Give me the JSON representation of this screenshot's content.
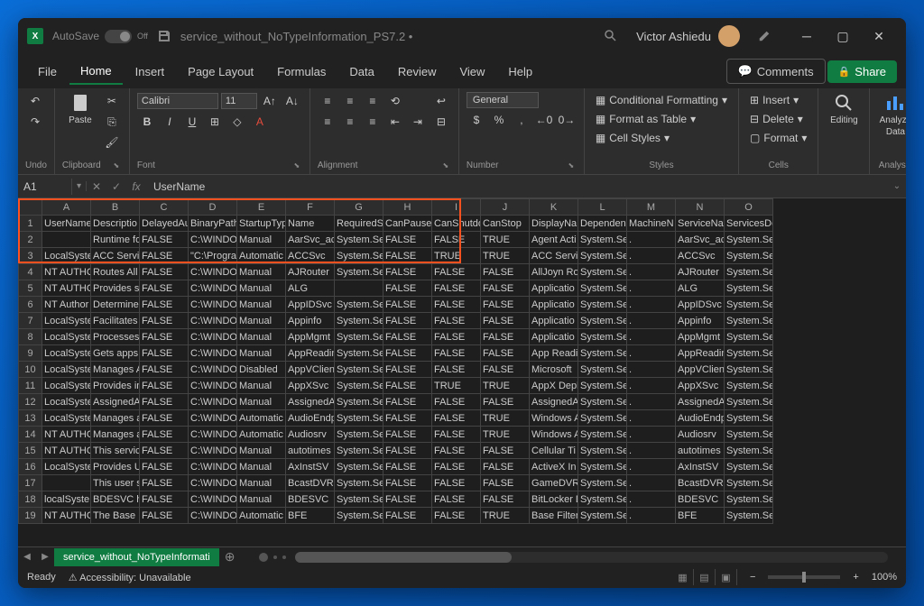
{
  "titlebar": {
    "autosave": "AutoSave",
    "toggle_state": "Off",
    "filename": "service_without_NoTypeInformation_PS7.2 •",
    "user": "Victor Ashiedu"
  },
  "menu": {
    "file": "File",
    "home": "Home",
    "insert": "Insert",
    "page_layout": "Page Layout",
    "formulas": "Formulas",
    "data": "Data",
    "review": "Review",
    "view": "View",
    "help": "Help",
    "comments": "Comments",
    "share": "Share"
  },
  "ribbon": {
    "undo": "Undo",
    "clipboard": "Clipboard",
    "paste": "Paste",
    "font_group": "Font",
    "font_name": "Calibri",
    "font_size": "11",
    "alignment": "Alignment",
    "number": "Number",
    "number_format": "General",
    "styles": "Styles",
    "cond_fmt": "Conditional Formatting",
    "fmt_table": "Format as Table",
    "cell_styles": "Cell Styles",
    "cells": "Cells",
    "insert": "Insert",
    "delete": "Delete",
    "format": "Format",
    "editing": "Editing",
    "analysis": "Analysis",
    "analyze": "Analyze",
    "analyze_data": "Data"
  },
  "formula_bar": {
    "name_box": "A1",
    "formula": "UserName"
  },
  "columns": [
    "A",
    "B",
    "C",
    "D",
    "E",
    "F",
    "G",
    "H",
    "I",
    "J",
    "K",
    "L",
    "M",
    "N",
    "O"
  ],
  "headers": [
    "UserName",
    "Descriptio",
    "DelayedAu",
    "BinaryPath",
    "StartupTyp",
    "Name",
    "RequiredSe",
    "CanPauseA",
    "CanShutdo",
    "CanStop",
    "DisplayNa",
    "Dependen",
    "MachineN",
    "ServiceNa",
    "ServicesDe"
  ],
  "rows": [
    {
      "n": 2,
      "d": [
        "",
        "Runtime fo",
        "FALSE",
        "C:\\WINDO",
        "Manual",
        "AarSvc_ac",
        "System.Se",
        "FALSE",
        "FALSE",
        "TRUE",
        "Agent Acti",
        "System.Se",
        ".",
        "AarSvc_ac",
        "System.Se"
      ]
    },
    {
      "n": 3,
      "d": [
        "LocalSyste",
        "ACC Servic",
        "FALSE",
        "\"C:\\Progra",
        "Automatic",
        "ACCSvc",
        "System.Se",
        "FALSE",
        "TRUE",
        "TRUE",
        "ACC Servic",
        "System.Se",
        ".",
        "ACCSvc",
        "System.Se"
      ]
    },
    {
      "n": 4,
      "d": [
        "NT AUTHO",
        "Routes All",
        "FALSE",
        "C:\\WINDO",
        "Manual",
        "AJRouter",
        "System.Se",
        "FALSE",
        "FALSE",
        "FALSE",
        "AllJoyn Ro",
        "System.Se",
        ".",
        "AJRouter",
        "System.Se"
      ]
    },
    {
      "n": 5,
      "d": [
        "NT AUTHO",
        "Provides s",
        "FALSE",
        "C:\\WINDO",
        "Manual",
        "ALG",
        "",
        "FALSE",
        "FALSE",
        "FALSE",
        "Applicatio",
        "System.Se",
        ".",
        "ALG",
        "System.Se"
      ]
    },
    {
      "n": 6,
      "d": [
        "NT Author",
        "Determine",
        "FALSE",
        "C:\\WINDO",
        "Manual",
        "AppIDSvc",
        "System.Se",
        "FALSE",
        "FALSE",
        "FALSE",
        "Applicatio",
        "System.Se",
        ".",
        "AppIDSvc",
        "System.Se"
      ]
    },
    {
      "n": 7,
      "d": [
        "LocalSyste",
        "Facilitates",
        "FALSE",
        "C:\\WINDO",
        "Manual",
        "Appinfo",
        "System.Se",
        "FALSE",
        "FALSE",
        "FALSE",
        "Applicatio",
        "System.Se",
        ".",
        "Appinfo",
        "System.Se"
      ]
    },
    {
      "n": 8,
      "d": [
        "LocalSyste",
        "Processes",
        "FALSE",
        "C:\\WINDO",
        "Manual",
        "AppMgmt",
        "System.Se",
        "FALSE",
        "FALSE",
        "FALSE",
        "Applicatio",
        "System.Se",
        ".",
        "AppMgmt",
        "System.Se"
      ]
    },
    {
      "n": 9,
      "d": [
        "LocalSyste",
        "Gets apps",
        "FALSE",
        "C:\\WINDO",
        "Manual",
        "AppReadin",
        "System.Se",
        "FALSE",
        "FALSE",
        "FALSE",
        "App Readi",
        "System.Se",
        ".",
        "AppReadin",
        "System.Se"
      ]
    },
    {
      "n": 10,
      "d": [
        "LocalSyste",
        "Manages A",
        "FALSE",
        "C:\\WINDO",
        "Disabled",
        "AppVClien",
        "System.Se",
        "FALSE",
        "FALSE",
        "FALSE",
        "Microsoft",
        "System.Se",
        ".",
        "AppVClien",
        "System.Se"
      ]
    },
    {
      "n": 11,
      "d": [
        "LocalSyste",
        "Provides in",
        "FALSE",
        "C:\\WINDO",
        "Manual",
        "AppXSvc",
        "System.Se",
        "FALSE",
        "TRUE",
        "TRUE",
        "AppX Depl",
        "System.Se",
        ".",
        "AppXSvc",
        "System.Se"
      ]
    },
    {
      "n": 12,
      "d": [
        "LocalSyste",
        "AssignedA",
        "FALSE",
        "C:\\WINDO",
        "Manual",
        "AssignedA",
        "System.Se",
        "FALSE",
        "FALSE",
        "FALSE",
        "AssignedA",
        "System.Se",
        ".",
        "AssignedA",
        "System.Se"
      ]
    },
    {
      "n": 13,
      "d": [
        "LocalSyste",
        "Manages a",
        "FALSE",
        "C:\\WINDO",
        "Automatic",
        "AudioEndp",
        "System.Se",
        "FALSE",
        "FALSE",
        "TRUE",
        "Windows A",
        "System.Se",
        ".",
        "AudioEndp",
        "System.Se"
      ]
    },
    {
      "n": 14,
      "d": [
        "NT AUTHO",
        "Manages a",
        "FALSE",
        "C:\\WINDO",
        "Automatic",
        "Audiosrv",
        "System.Se",
        "FALSE",
        "FALSE",
        "TRUE",
        "Windows A",
        "System.Se",
        ".",
        "Audiosrv",
        "System.Se"
      ]
    },
    {
      "n": 15,
      "d": [
        "NT AUTHO",
        "This servic",
        "FALSE",
        "C:\\WINDO",
        "Manual",
        "autotimes",
        "System.Se",
        "FALSE",
        "FALSE",
        "FALSE",
        "Cellular Ti",
        "System.Se",
        ".",
        "autotimes",
        "System.Se"
      ]
    },
    {
      "n": 16,
      "d": [
        "LocalSyste",
        "Provides U",
        "FALSE",
        "C:\\WINDO",
        "Manual",
        "AxInstSV",
        "System.Se",
        "FALSE",
        "FALSE",
        "FALSE",
        "ActiveX In",
        "System.Se",
        ".",
        "AxInstSV",
        "System.Se"
      ]
    },
    {
      "n": 17,
      "d": [
        "",
        "This user s",
        "FALSE",
        "C:\\WINDO",
        "Manual",
        "BcastDVRU",
        "System.Se",
        "FALSE",
        "FALSE",
        "FALSE",
        "GameDVR",
        "System.Se",
        ".",
        "BcastDVRU",
        "System.Se"
      ]
    },
    {
      "n": 18,
      "d": [
        "localSyste",
        "BDESVC ho",
        "FALSE",
        "C:\\WINDO",
        "Manual",
        "BDESVC",
        "System.Se",
        "FALSE",
        "FALSE",
        "FALSE",
        "BitLocker D",
        "System.Se",
        ".",
        "BDESVC",
        "System.Se"
      ]
    },
    {
      "n": 19,
      "d": [
        "NT AUTHO",
        "The Base F",
        "FALSE",
        "C:\\WINDO",
        "Automatic",
        "BFE",
        "System.Se",
        "FALSE",
        "FALSE",
        "TRUE",
        "Base Filter",
        "System.Se",
        ".",
        "BFE",
        "System.Se"
      ]
    }
  ],
  "sheet": {
    "name": "service_without_NoTypeInformati"
  },
  "status": {
    "ready": "Ready",
    "accessibility": "Accessibility: Unavailable",
    "zoom": "100%"
  }
}
